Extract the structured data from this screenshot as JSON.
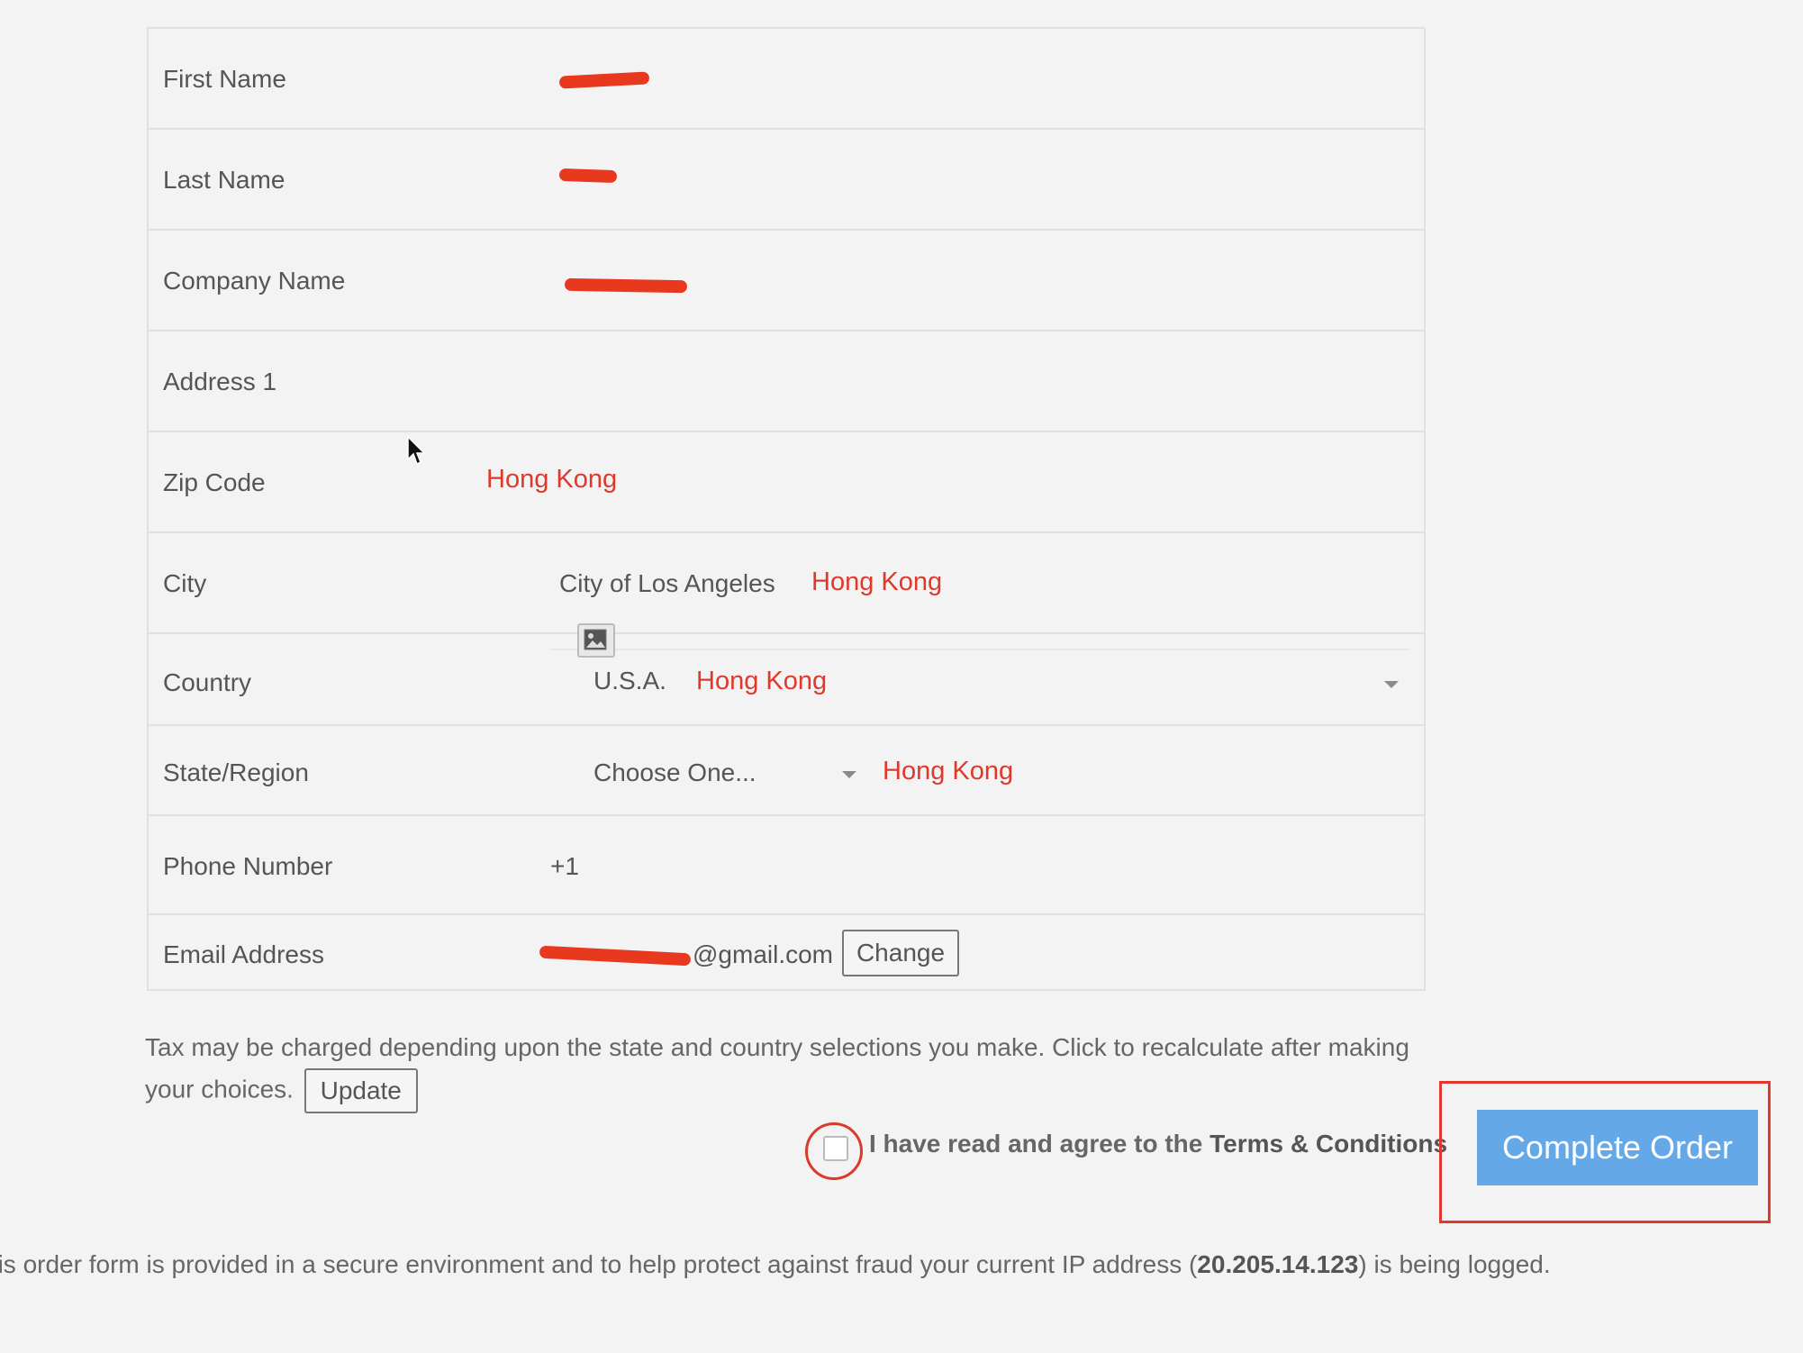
{
  "form": {
    "first_name": {
      "label": "First Name"
    },
    "last_name": {
      "label": "Last Name"
    },
    "company_name": {
      "label": "Company Name"
    },
    "address1": {
      "label": "Address 1"
    },
    "zip_code": {
      "label": "Zip Code",
      "note": "Hong Kong"
    },
    "city": {
      "label": "City",
      "value": "City of Los Angeles",
      "note": "Hong Kong"
    },
    "country": {
      "label": "Country",
      "value": "U.S.A.",
      "note": "Hong Kong"
    },
    "state": {
      "label": "State/Region",
      "value": "Choose One...",
      "note": "Hong Kong"
    },
    "phone": {
      "label": "Phone Number",
      "value": "+1"
    },
    "email": {
      "label": "Email Address",
      "value": "@gmail.com",
      "change_label": "Change"
    }
  },
  "tax": {
    "text_line1": "Tax may be charged depending upon the state and country selections you make. Click to recalculate after making",
    "text_line2": "your choices.",
    "update_label": "Update"
  },
  "terms": {
    "prefix": "I have read and agree to the ",
    "link": "Terms & Conditions"
  },
  "complete_order_label": "Complete Order",
  "footer": {
    "prefix": "his order form is provided in a secure environment and to help protect against fraud your current IP address (",
    "ip": "20.205.14.123",
    "suffix": ") is being logged."
  },
  "colors": {
    "annotation_red": "#e0382a",
    "button_blue": "#64a8e7"
  },
  "icons": [
    "image-icon",
    "chevron-down-icon",
    "cursor-icon"
  ]
}
